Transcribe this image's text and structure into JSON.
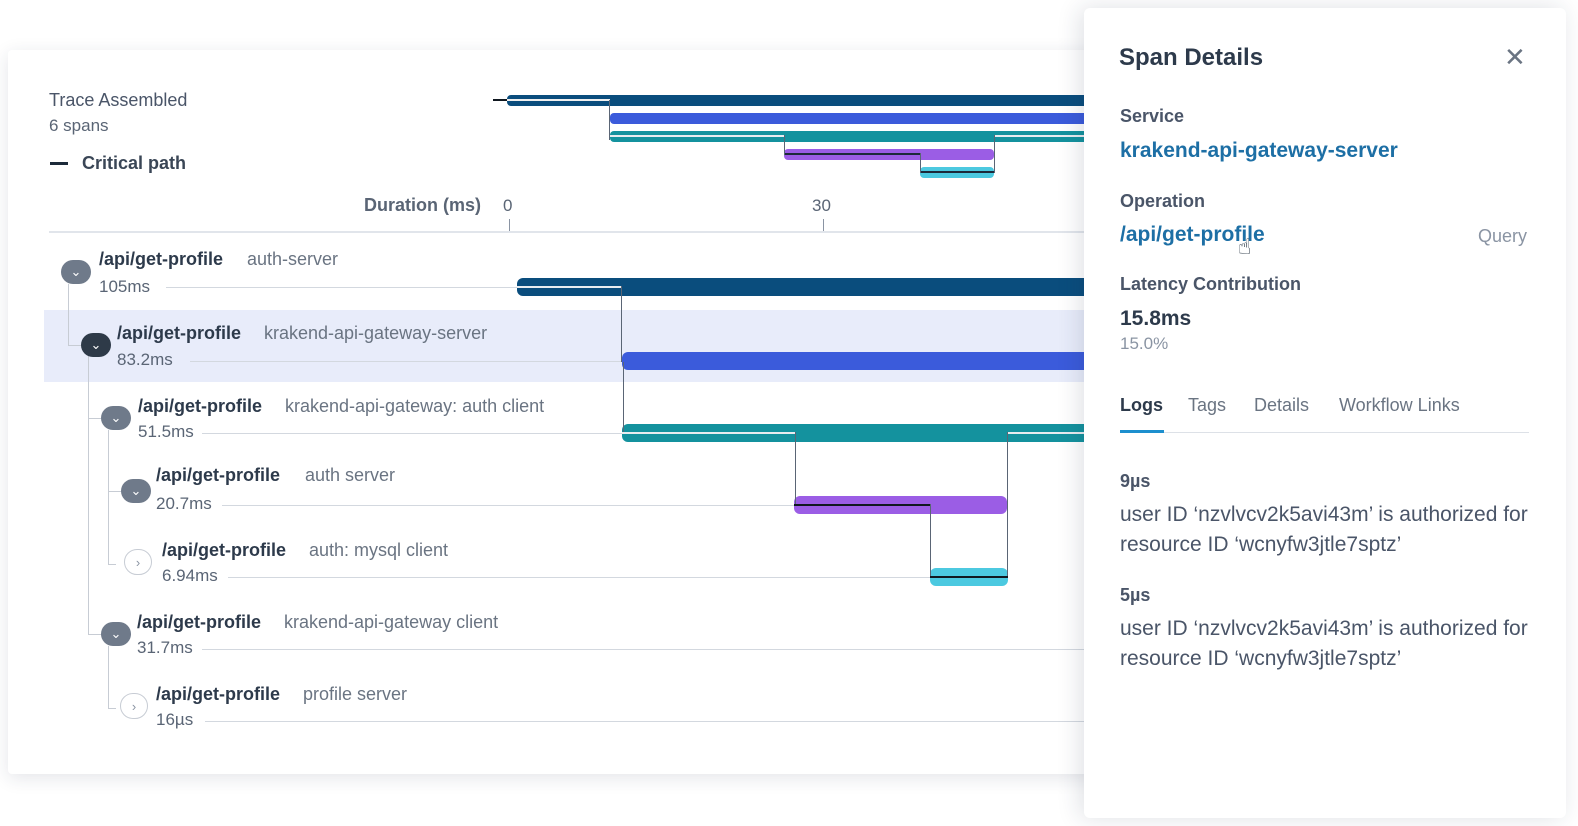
{
  "header": {
    "title": "Trace Assembled",
    "span_count": "6 spans",
    "critical_path_label": "Critical path"
  },
  "axis": {
    "title": "Duration (ms)",
    "ticks": [
      "0",
      "30"
    ]
  },
  "spans": [
    {
      "operation": "/api/get-profile",
      "service": "auth-server",
      "duration": "105ms",
      "toggle": "expanded",
      "selected": false,
      "color": "#0a4d7d"
    },
    {
      "operation": "/api/get-profile",
      "service": "krakend-api-gateway-server",
      "duration": "83.2ms",
      "toggle": "expanded",
      "selected": true,
      "color": "#3b5bdb"
    },
    {
      "operation": "/api/get-profile",
      "service": "krakend-api-gateway: auth client",
      "duration": "51.5ms",
      "toggle": "expanded",
      "selected": false,
      "color": "#14929e"
    },
    {
      "operation": "/api/get-profile",
      "service": "auth server",
      "duration": "20.7ms",
      "toggle": "expanded",
      "selected": false,
      "color": "#9b5de5"
    },
    {
      "operation": "/api/get-profile",
      "service": "auth: mysql client",
      "duration": "6.94ms",
      "toggle": "collapsed",
      "selected": false,
      "color": "#4cc9e0"
    },
    {
      "operation": "/api/get-profile",
      "service": "krakend-api-gateway client",
      "duration": "31.7ms",
      "toggle": "expanded",
      "selected": false,
      "color": ""
    },
    {
      "operation": "/api/get-profile",
      "service": "profile server",
      "duration": "16µs",
      "toggle": "collapsed",
      "selected": false,
      "color": ""
    }
  ],
  "panel": {
    "title": "Span Details",
    "service_label": "Service",
    "service_value": "krakend-api-gateway-server",
    "operation_label": "Operation",
    "operation_value": "/api/get-profile",
    "query_label": "Query",
    "latency_label": "Latency Contribution",
    "latency_value": "15.8ms",
    "latency_pct": "15.0%",
    "tabs": [
      "Logs",
      "Tags",
      "Details",
      "Workflow Links"
    ],
    "active_tab": "Logs",
    "logs": [
      {
        "time": "9µs",
        "message": "user ID ‘nzvlvcv2k5avi43m’ is authorized for resource ID ‘wcnyfw3jtle7sptz’"
      },
      {
        "time": "5µs",
        "message": "user ID ‘nzvlvcv2k5avi43m’ is authorized for resource ID ‘wcnyfw3jtle7sptz’"
      }
    ]
  },
  "icons": {
    "close": "close-icon",
    "expand": "chevron-down-icon",
    "collapse": "chevron-right-icon",
    "cursor": "hand-pointer-icon"
  }
}
